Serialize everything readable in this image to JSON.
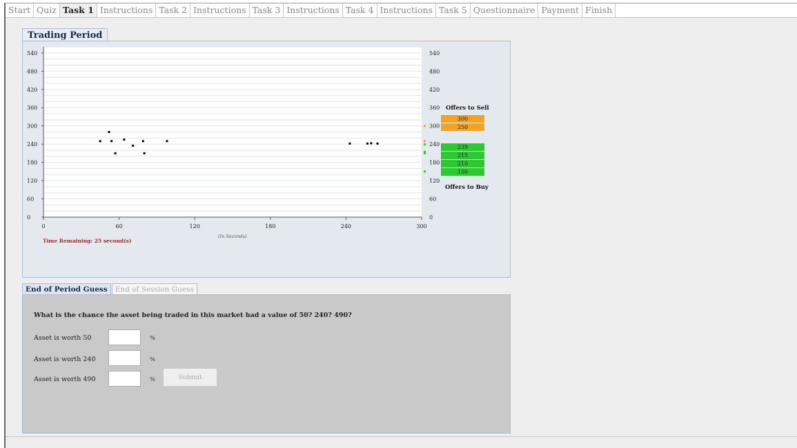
{
  "tabs": [
    {
      "label": "Start",
      "active": false
    },
    {
      "label": "Quiz",
      "active": false
    },
    {
      "label": "Task 1",
      "active": true
    },
    {
      "label": "Instructions",
      "active": false
    },
    {
      "label": "Task 2",
      "active": false
    },
    {
      "label": "Instructions",
      "active": false
    },
    {
      "label": "Task 3",
      "active": false
    },
    {
      "label": "Instructions",
      "active": false
    },
    {
      "label": "Task 4",
      "active": false
    },
    {
      "label": "Instructions",
      "active": false
    },
    {
      "label": "Task 5",
      "active": false
    },
    {
      "label": "Questionnaire",
      "active": false
    },
    {
      "label": "Payment",
      "active": false
    },
    {
      "label": "Finish",
      "active": false
    }
  ],
  "trading": {
    "tab_label": "Trading Period",
    "time_remaining": "Time Remaining: 25 second(s)",
    "x_unit_label": "(In Seconds)",
    "offers_to_sell_label": "Offers to Sell",
    "offers_to_buy_label": "Offers to Buy",
    "sell_offers": [
      "300",
      "250"
    ],
    "buy_offers": [
      "239",
      "215",
      "210",
      "150"
    ],
    "colors": {
      "sell": "#f5a21c",
      "buy": "#2fc733",
      "trade": "#000000"
    }
  },
  "chart_data": {
    "type": "scatter",
    "title": "",
    "xlabel": "(In Seconds)",
    "ylabel": "",
    "xlim": [
      0,
      300
    ],
    "ylim": [
      0,
      560
    ],
    "x_ticks": [
      0,
      60,
      120,
      180,
      240,
      300
    ],
    "y_ticks": [
      0,
      60,
      120,
      180,
      240,
      300,
      360,
      420,
      480,
      540
    ],
    "y_tick_labels": [
      "0",
      "60",
      "120",
      "180",
      "240",
      "300",
      "360",
      "420",
      "480",
      "540"
    ],
    "grid": true,
    "series": [
      {
        "name": "",
        "points": [
          [
            45,
            250
          ],
          [
            52,
            280
          ],
          [
            54,
            250
          ],
          [
            57,
            210
          ],
          [
            64,
            255
          ],
          [
            71,
            235
          ],
          [
            79,
            250
          ],
          [
            80,
            210
          ],
          [
            98,
            250
          ],
          [
            243,
            242
          ],
          [
            257,
            242
          ],
          [
            260,
            243
          ],
          [
            265,
            242
          ]
        ]
      }
    ],
    "right_markers": {
      "sell": [
        300,
        250
      ],
      "buy": [
        239,
        215,
        210,
        150
      ]
    }
  },
  "guess": {
    "tab_active": "End of Period Guess",
    "tab_inactive": "End of Session Guess",
    "question": "What is the chance the asset being traded in this market had a value of 50? 240? 490?",
    "rows": [
      {
        "label": "Asset is worth 50",
        "value": "",
        "unit": "%"
      },
      {
        "label": "Asset is worth 240",
        "value": "",
        "unit": "%"
      },
      {
        "label": "Asset is worth 490",
        "value": "",
        "unit": "%"
      }
    ],
    "submit_label": "Submit"
  }
}
